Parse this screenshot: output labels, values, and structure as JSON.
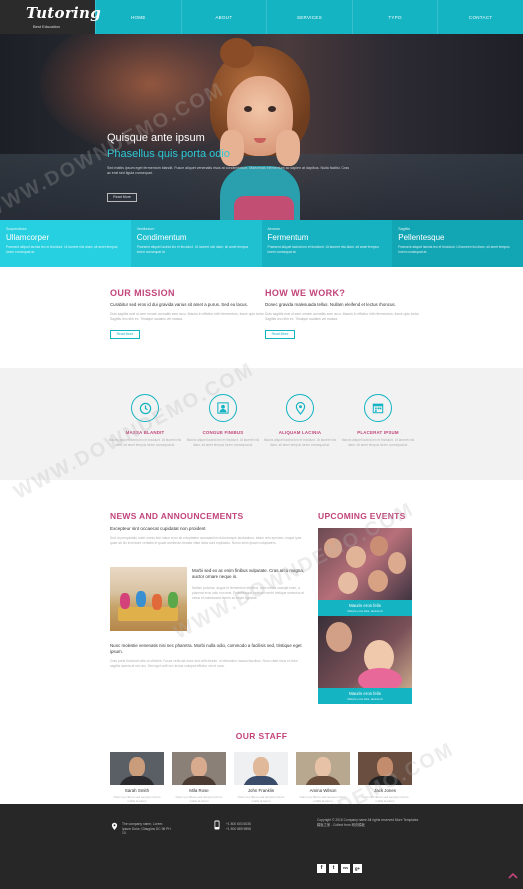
{
  "header": {
    "logo_title": "Tutoring",
    "logo_sub": "Best Education",
    "nav": [
      "HOME",
      "ABOUT",
      "SERVICES",
      "TYPO",
      "CONTACT"
    ]
  },
  "hero": {
    "title": "Quisque ante ipsum",
    "subtitle": "Phasellus quis porta odio",
    "text": "Sed mattis ipsum eget fermentum blandit. Fusce aliquet venenatis risus at condimentum. Maecenas elementum ac sapien at dapibus. Nulla facilisi. Cras ac erat sed ligula consequat.",
    "button": "Read More"
  },
  "features": [
    {
      "small": "Suspendisse",
      "title": "Ullamcorper",
      "text": "Praesent aliquet lacinia leo et tincidunt. Ut laoreet nisi diam, sit amet tempus lorem consequat at.",
      "color": "#27d0e0"
    },
    {
      "small": "Vestibulum",
      "title": "Condimentum",
      "text": "Praesent aliquet lacinia leo et tincidunt. Ut laoreet nisi diam, sit amet tempus lorem consequat at.",
      "color": "#1fc0d0"
    },
    {
      "small": "Aenean",
      "title": "Fermentum",
      "text": "Praesent aliquet lacinia leo et tincidunt. Ut laoreet nisi diam, sit amet tempus lorem consequat at.",
      "color": "#17b2c1"
    },
    {
      "small": "Sagittis",
      "title": "Pellentesque",
      "text": "Praesent aliquet lacinia leo et tincidunt. Ut laoreet nisi diam, sit amet tempus lorem consequat at.",
      "color": "#12a5b4"
    }
  ],
  "mission": {
    "title": "OUR MISSION",
    "lead": "Curabitur sed eros id dui gravida varius sit amet a purus. Sed eu lacus.",
    "text": "Duis sagittis erat ut sem ornare convallis sem arcu. Mauris in efficitur nibh fermentum, fusce quis tortor. Sagittis leo nibh ex. Tristique sodales vel massa.",
    "button": "Read More"
  },
  "howwork": {
    "title": "HOW WE WORK?",
    "lead": "Donec gravida malesuada tellus. Nullam eleifend et lectus rhoncus.",
    "text": "Duis sagittis erat ut sem ornare convallis sem arcu. Mauris in efficitur nibh fermentum, fusce quis tortor. Sagittis leo nibh ex. Tristique sodales vel massa.",
    "button": "Read More"
  },
  "services": [
    {
      "icon": "clock-icon",
      "glyph": "◷",
      "title": "MASSA BLANDIT",
      "text": "Mauris aliquet lacinia leo et tincidunt. Ut laoreet nisi diam, sit amet tempus lorem consequat at."
    },
    {
      "icon": "user-icon",
      "glyph": "●",
      "title": "CONGUE FINIBUS",
      "text": "Mauris aliquet lacinia leo et tincidunt. Ut laoreet nisi diam, sit amet tempus lorem consequat at."
    },
    {
      "icon": "map-marker-icon",
      "glyph": "⬤",
      "title": "ALIQUAM LACINIA",
      "text": "Mauris aliquet lacinia leo et tincidunt. Ut laoreet nisi diam, sit amet tempus lorem consequat at."
    },
    {
      "icon": "calendar-icon",
      "glyph": "▦",
      "title": "PLACERAT IPSUM",
      "text": "Mauris aliquet lacinia leo et tincidunt. Ut laoreet nisi diam, sit amet tempus lorem consequat at."
    }
  ],
  "news": {
    "title": "NEWS AND ANNOUNCEMENTS",
    "sub": "Excepteur sint occaecat cupidatat non proident",
    "text1": "Sed ut perspiciatis unde omnis iste natus error sit voluptatem accusantium doloremque laudantium, totam rem aperiam, eaque ipsa quae ab illo inventore veritatis et quasi architecto beatae vitae dicta sunt explicabo. Nemo enim ipsam voluptatem.",
    "mid_lead": "Morbi sed ex ac enim finibus vulputate. Cras arcu magna, auctor ornare neque in.",
    "mid_text": "Nullam pulvinar, augue id fermentum eleifend, ante metus suscipit enim, a placerat eros odio non erat. Pellentesque habitant morbi tristique senectus et netus et malesuada fames ac turpis egestas.",
    "bottom_lead": "Nunc molestie venenatis nisi nec pharetra. Morbi nulla odio, commodo a facilisis sed, tristique eget ipsum.",
    "bottom_text": "Cras porta tincidunt odio ut ultricies. Fusce vehicula dolor sed velit dictum, in bibendum massa faucibus. Nunc vitae risus et dolor sagittis lacinia at nec dui. Sed eget velit nec lectus volutpat efficitur vel et nunc."
  },
  "events": {
    "title": "UPCOMING EVENTS",
    "items": [
      {
        "title": "Mauris eros felis",
        "date": "Mauris eros felis, lacinia id"
      },
      {
        "title": "Mauris eros felis",
        "date": "Mauris eros felis, lacinia id"
      }
    ]
  },
  "staff": {
    "title": "OUR STAFF",
    "members": [
      {
        "name": "Sarah Smith",
        "text": "Nunc nec libero sed tempus rutrum mollis at lorem"
      },
      {
        "name": "Mila Rose",
        "text": "Nunc nec libero sed tempus rutrum mollis at lorem"
      },
      {
        "name": "John Franklin",
        "text": "Nunc nec libero sed tempus rutrum mollis at lorem"
      },
      {
        "name": "Amina Wilson",
        "text": "Nunc nec libero sed tempus rutrum mollis at lorem"
      },
      {
        "name": "Jack Jones",
        "text": "Nunc nec libero sed tempus rutrum mollis at lorem"
      }
    ]
  },
  "footer": {
    "address": "The company name, Lorem Ipsum Dolor, Glasglow DC 96 PH 10.",
    "phone": "+1 800 603 6035\n+1 800 889 9898",
    "copyright": "Copyright © 2015 Company name All rights reserved More Templates 模板之家 - Collect from 网页模板",
    "social": [
      "f",
      "t",
      "rss",
      "g+"
    ]
  },
  "watermark": "WWW.DOWNDEMO.COM"
}
